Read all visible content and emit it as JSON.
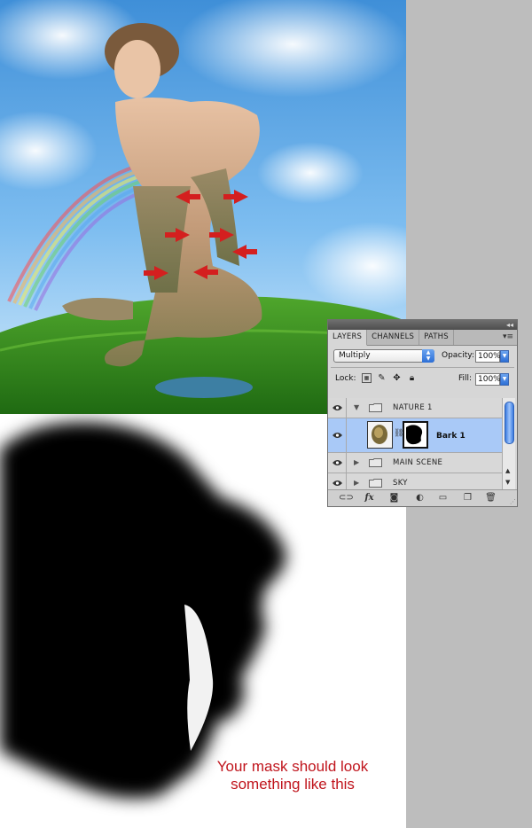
{
  "caption": {
    "line1": "Your mask should look",
    "line2": "something like this"
  },
  "layers_panel": {
    "tabs": [
      "LAYERS",
      "CHANNELS",
      "PATHS"
    ],
    "active_tab": "LAYERS",
    "blend_mode": "Multiply",
    "opacity_label": "Opacity:",
    "opacity_value": "100%",
    "lock_label": "Lock:",
    "fill_label": "Fill:",
    "fill_value": "100%",
    "layers": [
      {
        "name": "NATURE 1",
        "type": "group",
        "expanded": true
      },
      {
        "name": "Bark 1",
        "type": "layer",
        "selected": true,
        "has_mask": true
      },
      {
        "name": "MAIN SCENE",
        "type": "group",
        "expanded": false
      },
      {
        "name": "SKY",
        "type": "group",
        "expanded": false
      }
    ],
    "bottom_icons": [
      "link-icon",
      "fx-icon",
      "add-mask-icon",
      "adjustment-layer-icon",
      "new-group-icon",
      "new-layer-icon",
      "trash-icon"
    ]
  },
  "colors": {
    "caption": "#c0141c",
    "selection": "#a9c9f7",
    "arrows": "#d41f1f",
    "gray_background": "#bdbdbd"
  }
}
